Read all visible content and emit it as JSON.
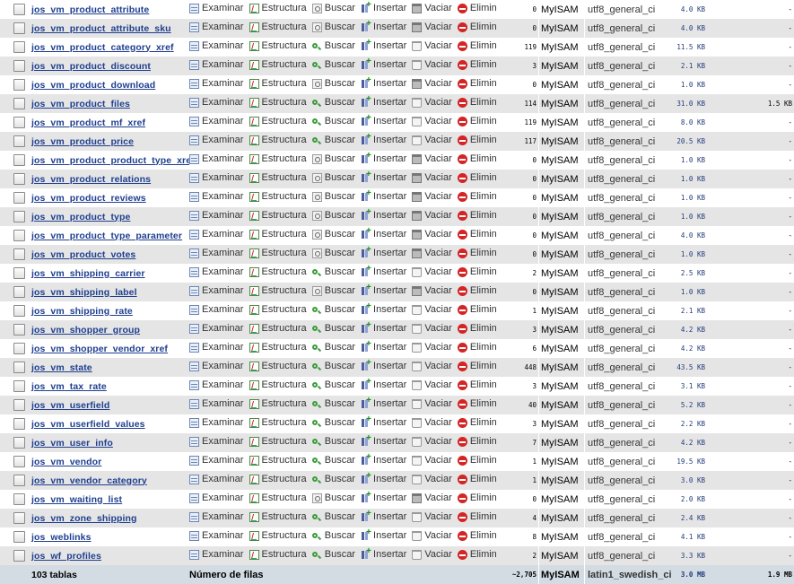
{
  "labels": {
    "browse": "Examinar",
    "structure": "Estructura",
    "search": "Buscar",
    "insert": "Insertar",
    "empty": "Vaciar",
    "drop": "Eliminar"
  },
  "rows": [
    {
      "name": "jos_vm_product_attribute",
      "rows": "0",
      "engine": "MyISAM",
      "collation": "utf8_general_ci",
      "size": "4.0 KB",
      "overhead": "-"
    },
    {
      "name": "jos_vm_product_attribute_sku",
      "rows": "0",
      "engine": "MyISAM",
      "collation": "utf8_general_ci",
      "size": "4.0 KB",
      "overhead": "-"
    },
    {
      "name": "jos_vm_product_category_xref",
      "rows": "119",
      "engine": "MyISAM",
      "collation": "utf8_general_ci",
      "size": "11.5 KB",
      "overhead": "-"
    },
    {
      "name": "jos_vm_product_discount",
      "rows": "3",
      "engine": "MyISAM",
      "collation": "utf8_general_ci",
      "size": "2.1 KB",
      "overhead": "-"
    },
    {
      "name": "jos_vm_product_download",
      "rows": "0",
      "engine": "MyISAM",
      "collation": "utf8_general_ci",
      "size": "1.0 KB",
      "overhead": "-"
    },
    {
      "name": "jos_vm_product_files",
      "rows": "114",
      "engine": "MyISAM",
      "collation": "utf8_general_ci",
      "size": "31.0 KB",
      "overhead": "1.5 KB"
    },
    {
      "name": "jos_vm_product_mf_xref",
      "rows": "119",
      "engine": "MyISAM",
      "collation": "utf8_general_ci",
      "size": "8.0 KB",
      "overhead": "-"
    },
    {
      "name": "jos_vm_product_price",
      "rows": "117",
      "engine": "MyISAM",
      "collation": "utf8_general_ci",
      "size": "20.5 KB",
      "overhead": "-"
    },
    {
      "name": "jos_vm_product_product_type_xref",
      "rows": "0",
      "engine": "MyISAM",
      "collation": "utf8_general_ci",
      "size": "1.0 KB",
      "overhead": "-"
    },
    {
      "name": "jos_vm_product_relations",
      "rows": "0",
      "engine": "MyISAM",
      "collation": "utf8_general_ci",
      "size": "1.0 KB",
      "overhead": "-"
    },
    {
      "name": "jos_vm_product_reviews",
      "rows": "0",
      "engine": "MyISAM",
      "collation": "utf8_general_ci",
      "size": "1.0 KB",
      "overhead": "-"
    },
    {
      "name": "jos_vm_product_type",
      "rows": "0",
      "engine": "MyISAM",
      "collation": "utf8_general_ci",
      "size": "1.0 KB",
      "overhead": "-"
    },
    {
      "name": "jos_vm_product_type_parameter",
      "rows": "0",
      "engine": "MyISAM",
      "collation": "utf8_general_ci",
      "size": "4.0 KB",
      "overhead": "-"
    },
    {
      "name": "jos_vm_product_votes",
      "rows": "0",
      "engine": "MyISAM",
      "collation": "utf8_general_ci",
      "size": "1.0 KB",
      "overhead": "-"
    },
    {
      "name": "jos_vm_shipping_carrier",
      "rows": "2",
      "engine": "MyISAM",
      "collation": "utf8_general_ci",
      "size": "2.5 KB",
      "overhead": "-"
    },
    {
      "name": "jos_vm_shipping_label",
      "rows": "0",
      "engine": "MyISAM",
      "collation": "utf8_general_ci",
      "size": "1.0 KB",
      "overhead": "-"
    },
    {
      "name": "jos_vm_shipping_rate",
      "rows": "1",
      "engine": "MyISAM",
      "collation": "utf8_general_ci",
      "size": "2.1 KB",
      "overhead": "-"
    },
    {
      "name": "jos_vm_shopper_group",
      "rows": "3",
      "engine": "MyISAM",
      "collation": "utf8_general_ci",
      "size": "4.2 KB",
      "overhead": "-"
    },
    {
      "name": "jos_vm_shopper_vendor_xref",
      "rows": "6",
      "engine": "MyISAM",
      "collation": "utf8_general_ci",
      "size": "4.2 KB",
      "overhead": "-"
    },
    {
      "name": "jos_vm_state",
      "rows": "448",
      "engine": "MyISAM",
      "collation": "utf8_general_ci",
      "size": "43.5 KB",
      "overhead": "-"
    },
    {
      "name": "jos_vm_tax_rate",
      "rows": "3",
      "engine": "MyISAM",
      "collation": "utf8_general_ci",
      "size": "3.1 KB",
      "overhead": "-"
    },
    {
      "name": "jos_vm_userfield",
      "rows": "40",
      "engine": "MyISAM",
      "collation": "utf8_general_ci",
      "size": "5.2 KB",
      "overhead": "-"
    },
    {
      "name": "jos_vm_userfield_values",
      "rows": "3",
      "engine": "MyISAM",
      "collation": "utf8_general_ci",
      "size": "2.2 KB",
      "overhead": "-"
    },
    {
      "name": "jos_vm_user_info",
      "rows": "7",
      "engine": "MyISAM",
      "collation": "utf8_general_ci",
      "size": "4.2 KB",
      "overhead": "-"
    },
    {
      "name": "jos_vm_vendor",
      "rows": "1",
      "engine": "MyISAM",
      "collation": "utf8_general_ci",
      "size": "19.5 KB",
      "overhead": "-"
    },
    {
      "name": "jos_vm_vendor_category",
      "rows": "1",
      "engine": "MyISAM",
      "collation": "utf8_general_ci",
      "size": "3.0 KB",
      "overhead": "-"
    },
    {
      "name": "jos_vm_waiting_list",
      "rows": "0",
      "engine": "MyISAM",
      "collation": "utf8_general_ci",
      "size": "2.0 KB",
      "overhead": "-"
    },
    {
      "name": "jos_vm_zone_shipping",
      "rows": "4",
      "engine": "MyISAM",
      "collation": "utf8_general_ci",
      "size": "2.4 KB",
      "overhead": "-"
    },
    {
      "name": "jos_weblinks",
      "rows": "8",
      "engine": "MyISAM",
      "collation": "utf8_general_ci",
      "size": "4.1 KB",
      "overhead": "-"
    },
    {
      "name": "jos_wf_profiles",
      "rows": "2",
      "engine": "MyISAM",
      "collation": "utf8_general_ci",
      "size": "3.3 KB",
      "overhead": "-"
    }
  ],
  "footer": {
    "tables": "103 tablas",
    "rows_label": "Número de filas",
    "rows": "~2,705",
    "engine": "MyISAM",
    "collation": "latin1_swedish_ci",
    "size": "3.0 MB",
    "overhead": "1.9 MB"
  }
}
